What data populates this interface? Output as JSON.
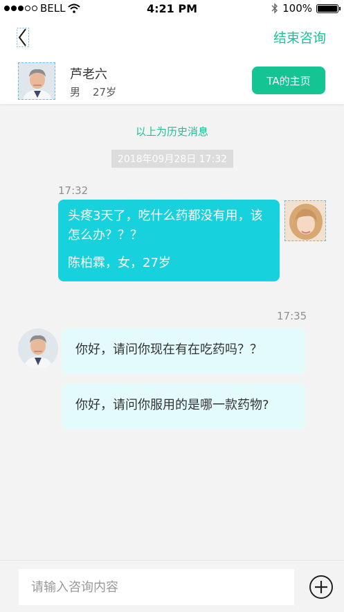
{
  "status_bar": {
    "carrier": "BELL",
    "time": "4:21 PM",
    "battery": "100%"
  },
  "nav": {
    "end_label": "结束咨询"
  },
  "doctor": {
    "name": "芦老六",
    "gender": "男",
    "age": "27岁",
    "home_button": "TA的主页"
  },
  "chat": {
    "history_label": "以上为历史消息",
    "date_label": "2018年09月28日   17:32",
    "messages": [
      {
        "time": "17:32",
        "line1": "头疼3天了，吃什么药都没有用，该怎么办？？？",
        "line2": "陈柏霖，女，27岁"
      },
      {
        "time": "17:35",
        "text": "你好，请问你现在有在吃药吗？？"
      },
      {
        "text": "你好，请问你服用的是哪一款药物?"
      }
    ]
  },
  "input": {
    "placeholder": "请输入咨询内容"
  },
  "colors": {
    "accent": "#1fbf9a",
    "button": "#14c493",
    "outgoing_bubble": "#17d1dc",
    "incoming_bubble": "#e4fbfb"
  }
}
